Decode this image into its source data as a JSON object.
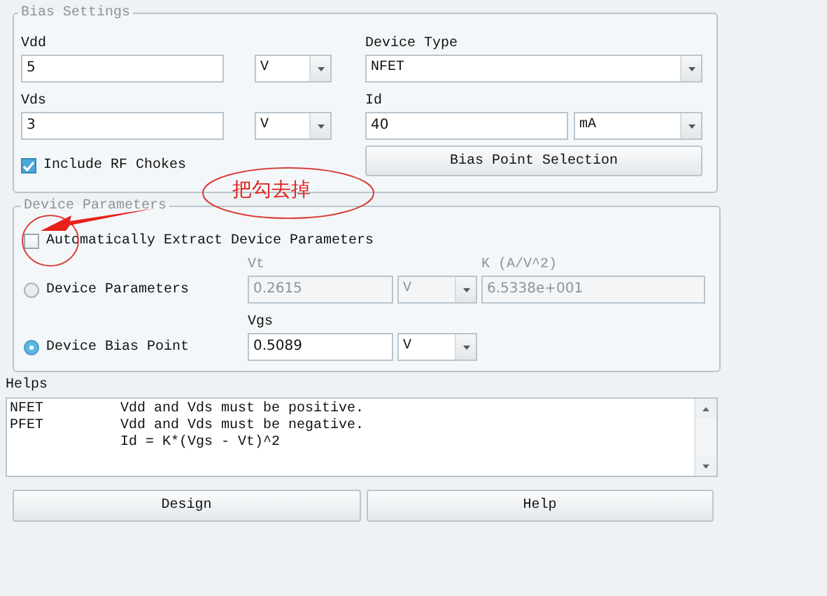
{
  "bias_settings": {
    "title": "Bias Settings",
    "vdd": {
      "label": "Vdd",
      "value": "5",
      "unit": "V"
    },
    "vds": {
      "label": "Vds",
      "value": "3",
      "unit": "V"
    },
    "include_rf_chokes": {
      "label": "Include RF Chokes",
      "checked": true
    },
    "device_type": {
      "label": "Device Type",
      "value": "NFET"
    },
    "id": {
      "label": "Id",
      "value": "40",
      "unit": "mA"
    },
    "bias_point_button": "Bias Point Selection"
  },
  "device_parameters": {
    "title": "Device Parameters",
    "auto_extract": {
      "label": "Automatically Extract Device Parameters",
      "checked": false
    },
    "modes": [
      {
        "label": "Device Parameters",
        "selected": false
      },
      {
        "label": "Device Bias Point",
        "selected": true
      }
    ],
    "vt": {
      "label": "Vt",
      "value": "0.2615",
      "unit": "V",
      "disabled": true
    },
    "k": {
      "label": "K (A/V^2)",
      "value": "6.5338e+001",
      "disabled": true
    },
    "vgs": {
      "label": "Vgs",
      "value": "0.5089",
      "unit": "V",
      "disabled": false
    }
  },
  "helps": {
    "label": "Helps",
    "lines": [
      {
        "type": "NFET",
        "text": "Vdd and Vds must be positive."
      },
      {
        "type": "PFET",
        "text": "Vdd and Vds must be negative."
      },
      {
        "text": "Id = K*(Vgs - Vt)^2"
      }
    ]
  },
  "buttons": [
    "Design",
    "Help"
  ],
  "annotation": {
    "text": "把勾去掉"
  }
}
